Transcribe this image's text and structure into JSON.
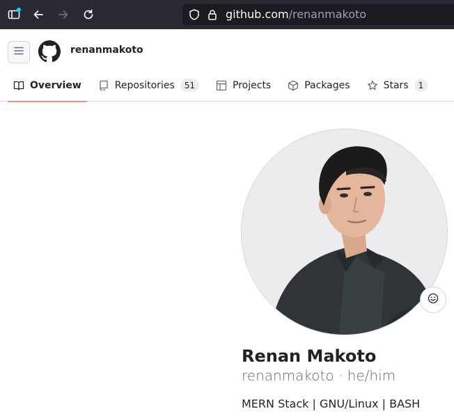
{
  "browser": {
    "url_host": "github.com",
    "url_path": "/renanmakoto",
    "icons": [
      "sidebar-icon",
      "back-icon",
      "forward-icon",
      "reload-icon",
      "shield-icon",
      "lock-icon"
    ]
  },
  "header": {
    "username": "renanmakoto"
  },
  "tabs": [
    {
      "label": "Overview",
      "icon": "book-icon",
      "active": true
    },
    {
      "label": "Repositories",
      "icon": "repo-icon",
      "count": "51"
    },
    {
      "label": "Projects",
      "icon": "table-icon"
    },
    {
      "label": "Packages",
      "icon": "package-icon"
    },
    {
      "label": "Stars",
      "icon": "star-icon",
      "count": "1"
    }
  ],
  "profile": {
    "name": "Renan Makoto",
    "login": "renanmakoto",
    "separator": "·",
    "pronouns": "he/him",
    "bio": "MERN Stack | GNU/Linux | BASH"
  },
  "colors": {
    "browser_bg": "#2b2a33",
    "url_bg": "#1c1b22",
    "tab_underline": "#fd8c73",
    "text": "#1f2328",
    "muted": "#636c76"
  }
}
